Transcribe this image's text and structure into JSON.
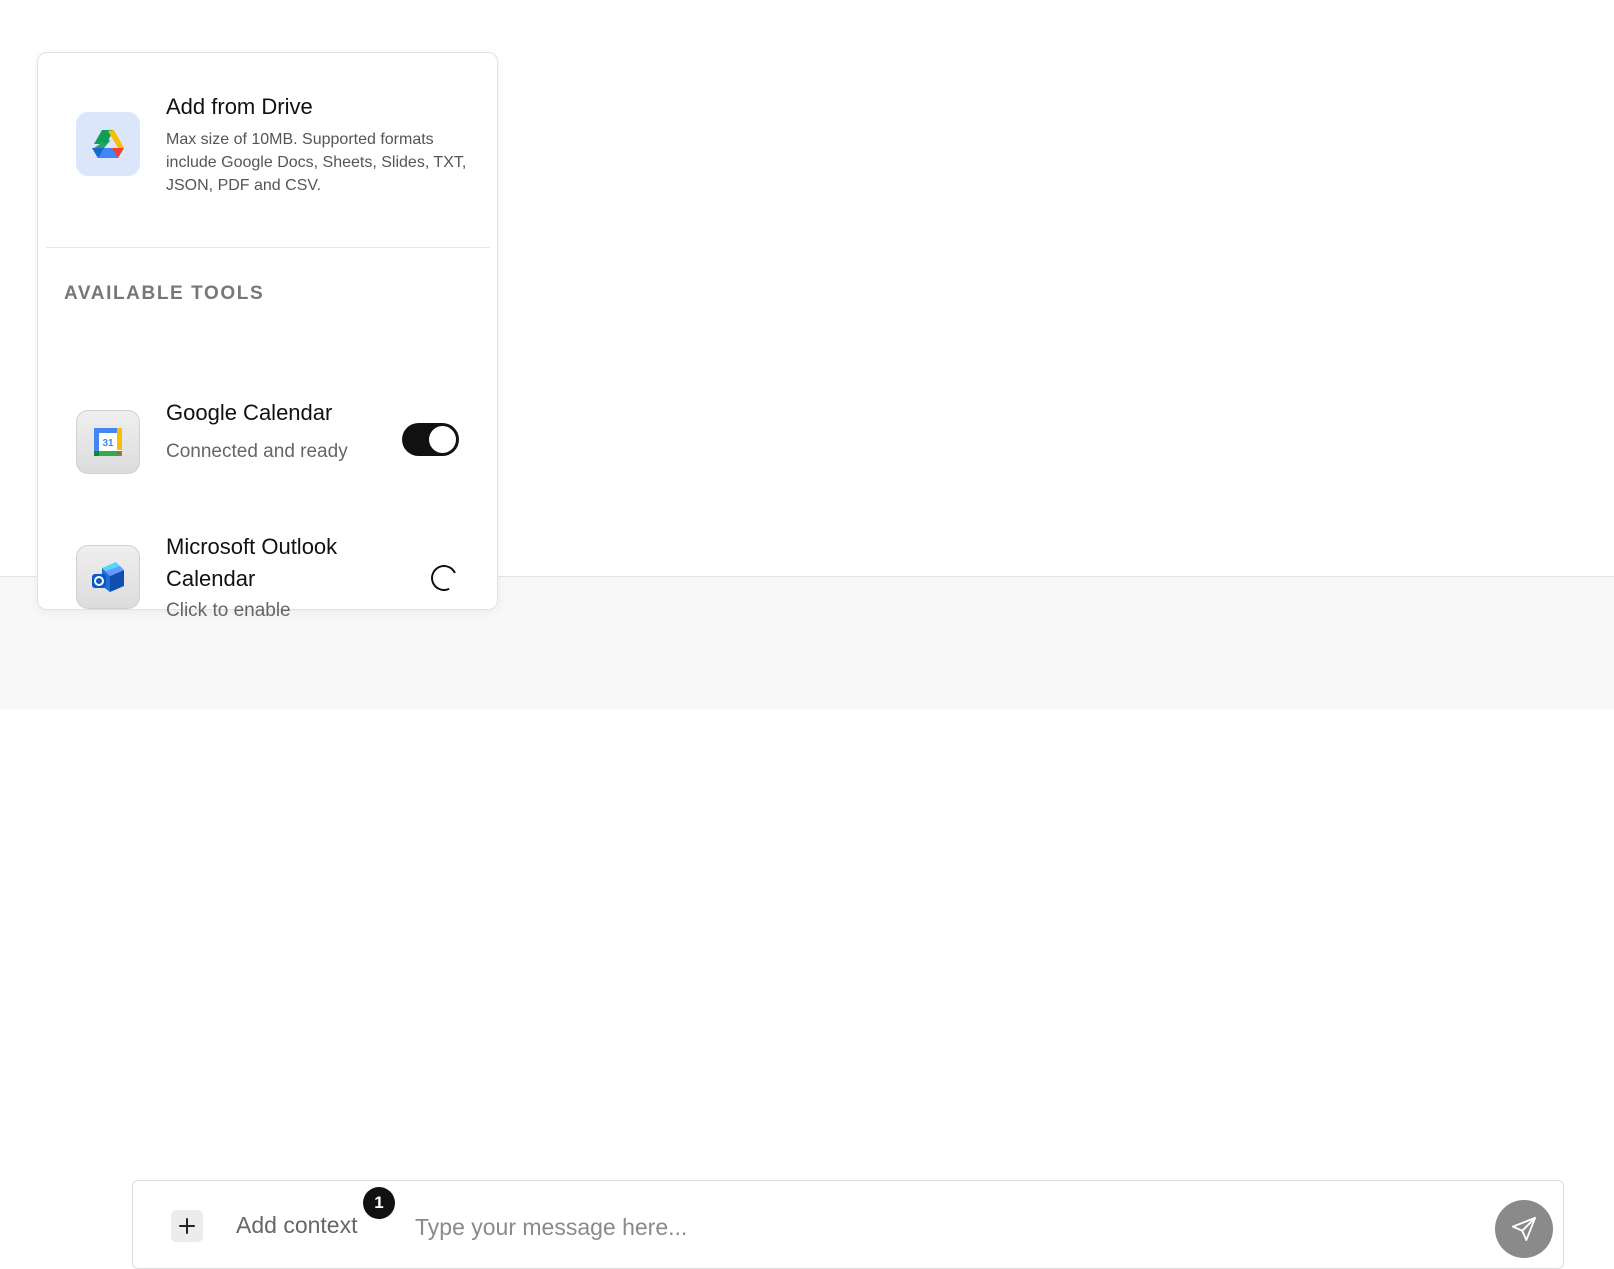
{
  "popover": {
    "drive": {
      "icon": "google-drive-icon",
      "title": "Add from Drive",
      "description": "Max size of 10MB. Supported formats include Google Docs, Sheets, Slides, TXT, JSON, PDF and CSV."
    },
    "section_label": "AVAILABLE TOOLS",
    "tools": [
      {
        "icon": "google-calendar-icon",
        "name": "Google Calendar",
        "status": "Connected and ready",
        "control": "toggle",
        "enabled": true
      },
      {
        "icon": "outlook-calendar-icon",
        "name": "Microsoft Outlook Calendar",
        "status": "Click to enable",
        "control": "spinner",
        "enabled": false
      }
    ]
  },
  "composer": {
    "plus_icon": "plus-icon",
    "add_context_label": "Add context",
    "context_count": "1",
    "placeholder": "Type your message here...",
    "value": "",
    "send_icon": "send-icon"
  },
  "colors": {
    "toggle_on": "#111111",
    "send_button": "#8a8a8a",
    "drive_tile": "#dbe6fb"
  }
}
